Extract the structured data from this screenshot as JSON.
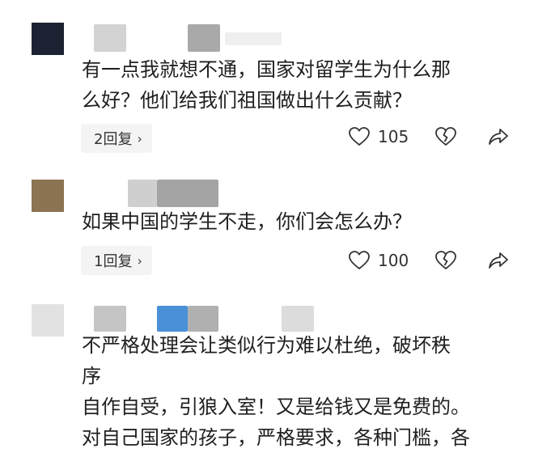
{
  "comments": [
    {
      "avatar_color": "#1c2232",
      "text_lines": [
        "有一点我就想不通，国家对留学生为什么那",
        "么好？他们给我们祖国做出什么贡献？"
      ],
      "reply_label": "2回复",
      "like_count": "105"
    },
    {
      "avatar_color": "#8c7352",
      "text_lines": [
        "如果中国的学生不走，你们会怎么办？"
      ],
      "reply_label": "1回复",
      "like_count": "100"
    },
    {
      "avatar_color": "#e2e2e2",
      "text_lines": [
        "不严格处理会让类似行为难以杜绝，破坏秩",
        "序",
        "自作自受，引狼入室！又是给钱又是免费的。",
        "对自己国家的孩子，严格要求，各种门槛，各"
      ]
    }
  ],
  "icons": {
    "like": "heart-icon",
    "dislike": "broken-heart-icon",
    "share": "share-arrow-icon",
    "chevron": "chevron-right-icon"
  },
  "colors": {
    "text": "#1f1f1f",
    "pill_bg": "#f4f4f4",
    "redaction_gray": "#c9c9c9",
    "redaction_blue": "#4a90d9"
  }
}
